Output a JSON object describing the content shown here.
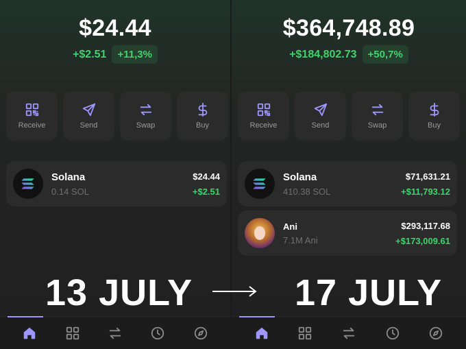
{
  "left": {
    "balance": "$24.44",
    "change_abs": "+$2.51",
    "change_pct": "+11,3%",
    "actions": [
      {
        "label": "Receive",
        "icon": "qr-code-icon"
      },
      {
        "label": "Send",
        "icon": "send-icon"
      },
      {
        "label": "Swap",
        "icon": "swap-icon"
      },
      {
        "label": "Buy",
        "icon": "dollar-icon"
      }
    ],
    "tokens": [
      {
        "name": "Solana",
        "amount": "0.14 SOL",
        "usd": "$24.44",
        "delta": "+$2.51",
        "icon": "solana-icon"
      }
    ],
    "date": "13 JULY"
  },
  "right": {
    "balance": "$364,748.89",
    "change_abs": "+$184,802.73",
    "change_pct": "+50,7%",
    "actions": [
      {
        "label": "Receive",
        "icon": "qr-code-icon"
      },
      {
        "label": "Send",
        "icon": "send-icon"
      },
      {
        "label": "Swap",
        "icon": "swap-icon"
      },
      {
        "label": "Buy",
        "icon": "dollar-icon"
      }
    ],
    "tokens": [
      {
        "name": "Solana",
        "amount": "410.38 SOL",
        "usd": "$71,631.21",
        "delta": "+$11,793.12",
        "icon": "solana-icon"
      },
      {
        "name": "Ani",
        "amount": "7.1M Ani",
        "usd": "$293,117.68",
        "delta": "+$173,009.61",
        "icon": "ani-avatar-icon"
      }
    ],
    "date": "17 JULY"
  },
  "tabbar": [
    "home-icon",
    "grid-icon",
    "swap-arrows-icon",
    "history-clock-icon",
    "compass-icon"
  ],
  "colors": {
    "accent": "#9f95ff",
    "positive": "#3ed46b",
    "card": "#2b2b2c"
  }
}
